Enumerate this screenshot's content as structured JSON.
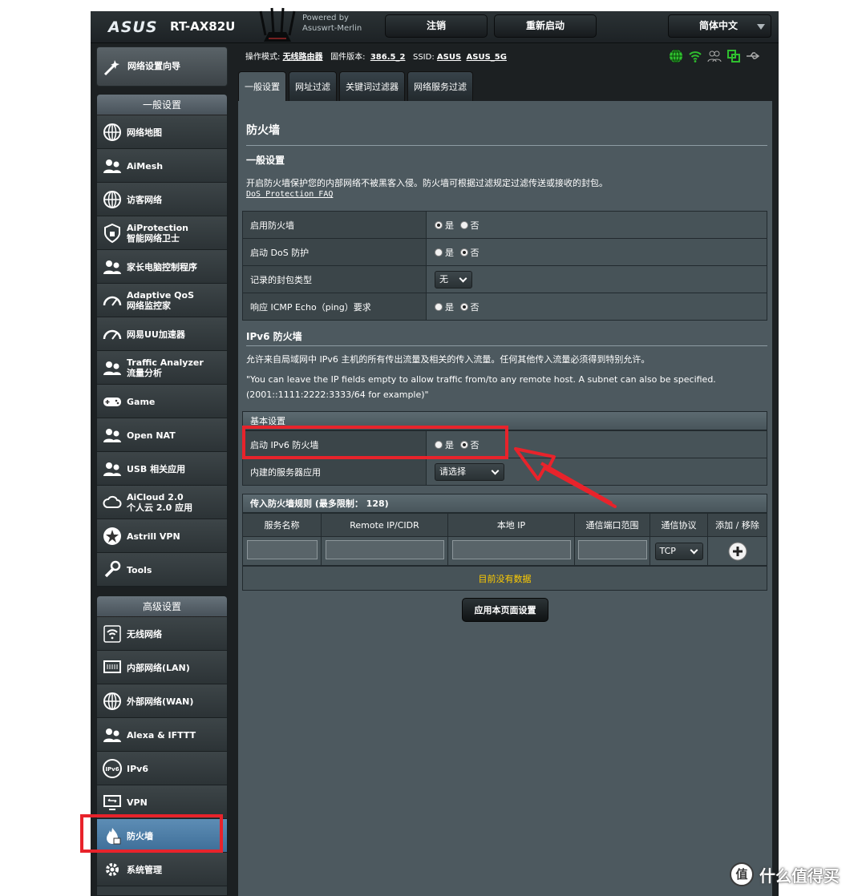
{
  "header": {
    "brand": "ASUS",
    "model": "RT-AX82U",
    "powered_line1": "Powered by",
    "powered_line2": "Asuswrt-Merlin",
    "logout_label": "注销",
    "reboot_label": "重新启动",
    "language": "简体中文"
  },
  "status": {
    "mode_label": "操作模式:",
    "mode_value": "无线路由器",
    "firmware_label": "固件版本:",
    "firmware_value": "386.5_2",
    "ssid_label": "SSID:",
    "ssid_1": "ASUS",
    "ssid_2": "ASUS_5G",
    "icons": [
      "globe-icon",
      "wifi-icon",
      "users-icon",
      "copy-icon",
      "usb-icon"
    ]
  },
  "sidebar": {
    "quick_setup": "网络设置向导",
    "general_title": "一般设置",
    "general_items": [
      {
        "label": "网络地图",
        "icon": "network-map-icon"
      },
      {
        "label": "AiMesh",
        "icon": "aimesh-icon"
      },
      {
        "label": "访客网络",
        "icon": "guest-network-icon"
      },
      {
        "label": "AiProtection",
        "label2": "智能网络卫士",
        "icon": "shield-icon"
      },
      {
        "label": "家长电脑控制程序",
        "icon": "parental-control-icon"
      },
      {
        "label": "Adaptive QoS",
        "label2": "网络监控家",
        "icon": "gauge-icon"
      },
      {
        "label": "网易UU加速器",
        "icon": "speedometer-icon"
      },
      {
        "label": "Traffic Analyzer",
        "label2": "流量分析",
        "icon": "analyzer-icon"
      },
      {
        "label": "Game",
        "icon": "gamepad-icon"
      },
      {
        "label": "Open NAT",
        "icon": "open-nat-icon"
      },
      {
        "label": "USB 相关应用",
        "icon": "usb-app-icon"
      },
      {
        "label": "AiCloud 2.0",
        "label2": "个人云 2.0 应用",
        "icon": "cloud-icon"
      },
      {
        "label": "Astrill VPN",
        "icon": "star-icon"
      },
      {
        "label": "Tools",
        "icon": "wrench-icon"
      }
    ],
    "advanced_title": "高级设置",
    "advanced_items": [
      {
        "label": "无线网络",
        "icon": "wireless-icon"
      },
      {
        "label": "内部网络(LAN)",
        "icon": "lan-icon"
      },
      {
        "label": "外部网络(WAN)",
        "icon": "wan-icon"
      },
      {
        "label": "Alexa & IFTTT",
        "icon": "alexa-icon"
      },
      {
        "label": "IPv6",
        "icon": "ipv6-icon"
      },
      {
        "label": "VPN",
        "icon": "vpn-icon"
      },
      {
        "label": "防火墙",
        "icon": "firewall-icon"
      },
      {
        "label": "系统管理",
        "icon": "admin-icon"
      }
    ]
  },
  "tabs": [
    "一般设置",
    "网址过滤",
    "关键词过滤器",
    "网络服务过滤"
  ],
  "page": {
    "title": "防火墙",
    "general_heading": "一般设置",
    "general_desc": "开启防火墙保护您的内部网络不被黑客入侵。防火墙可根据过滤规定过滤传送或接收的封包。",
    "faq_link": "DoS Protection FAQ",
    "rows": [
      {
        "label": "启用防火墙",
        "type": "radio",
        "yes": "是",
        "no": "否",
        "selected": "yes"
      },
      {
        "label": "启动 DoS 防护",
        "type": "radio",
        "yes": "是",
        "no": "否",
        "selected": "no"
      },
      {
        "label": "记录的封包类型",
        "type": "select",
        "value": "无"
      },
      {
        "label": "响应 ICMP Echo（ping）要求",
        "type": "radio",
        "yes": "是",
        "no": "否",
        "selected": "no"
      }
    ],
    "ipv6_heading": "IPv6 防火墙",
    "ipv6_desc": "允许来自局域网中 IPv6 主机的所有传出流量及相关的传入流量。任何其他传入流量必须得到特别允许。",
    "ipv6_note1": "\"You can leave the IP fields empty to allow traffic from/to any remote host. A subnet can also be specified.",
    "ipv6_note2": "(2001::1111:2222:3333/64 for example)\"",
    "basic_header": "基本设置",
    "ipv6_enable_label": "启动 IPv6 防火墙",
    "ipv6_yes": "是",
    "ipv6_no": "否",
    "builtin_label": "内建的服务器应用",
    "builtin_value": "请选择",
    "rules_header": "传入防火墙规则 (最多限制： 128)",
    "rules_columns": [
      "服务名称",
      "Remote IP/CIDR",
      "本地 IP",
      "通信端口范围",
      "通信协议",
      "添加 / 移除"
    ],
    "protocol_value": "TCP",
    "no_data": "目前没有数据",
    "apply_label": "应用本页面设置"
  },
  "watermark": {
    "logo": "值",
    "text": "什么值得买"
  },
  "colors": {
    "panel": "#4d595f",
    "frame": "#1c2022",
    "highlight": "#e8232b",
    "no_data": "#ffcc00",
    "active_item": "#4f7fa8"
  }
}
